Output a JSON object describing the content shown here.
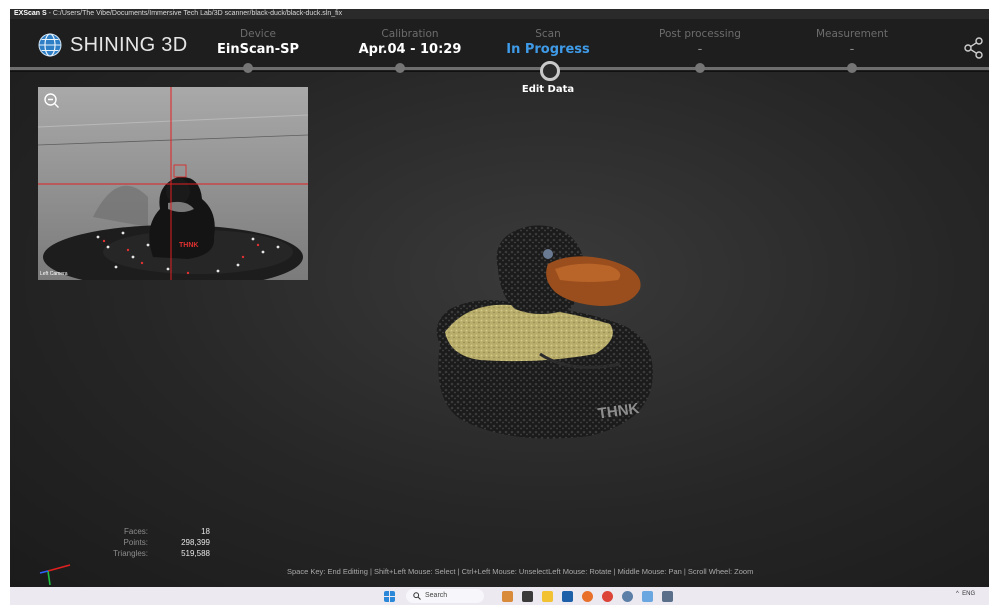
{
  "window": {
    "app_name": "EXScan S",
    "path": " - C:/Users/The Vibe/Documents/Immersive Tech Lab/3D scanner/black-duck/black-duck.sln_fix"
  },
  "brand": {
    "name": "SHINING 3D"
  },
  "steps": [
    {
      "caption": "Device",
      "value": "EinScan-SP"
    },
    {
      "caption": "Calibration",
      "value": "Apr.04 - 10:29"
    },
    {
      "caption": "Scan",
      "value": "In Progress"
    },
    {
      "caption": "Post processing",
      "value": "-"
    },
    {
      "caption": "Measurement",
      "value": "-"
    }
  ],
  "current_step_label": "Edit Data",
  "camera": {
    "label": "Left Camera"
  },
  "stats": [
    {
      "key": "Faces:",
      "value": "18"
    },
    {
      "key": "Points:",
      "value": "298,399"
    },
    {
      "key": "Triangles:",
      "value": "519,588"
    }
  ],
  "hint": "Space Key: End Editting | Shift+Left Mouse: Select | Ctrl+Left Mouse: UnselectLeft Mouse: Rotate | Middle Mouse: Pan | Scroll Wheel: Zoom",
  "taskbar": {
    "search_label": "Search",
    "tray_lang": "ENG"
  },
  "colors": {
    "accent": "#3f9be8",
    "background": "#2a2a2a",
    "scan_yellow": "#c9be7a",
    "beak": "#a0501c"
  }
}
